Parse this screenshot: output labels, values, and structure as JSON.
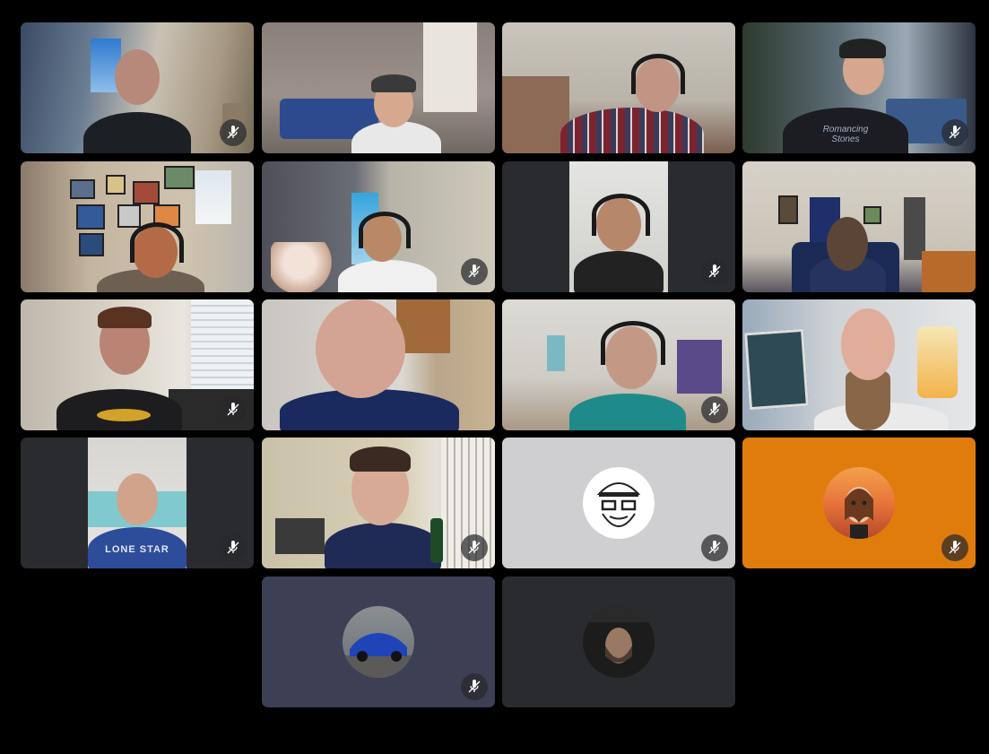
{
  "meeting": {
    "tiles": [
      {
        "id": "p1",
        "type": "video",
        "muted": true
      },
      {
        "id": "p2",
        "type": "video",
        "muted": false
      },
      {
        "id": "p3",
        "type": "video",
        "muted": false
      },
      {
        "id": "p4",
        "type": "video",
        "muted": true
      },
      {
        "id": "p5",
        "type": "video",
        "muted": false
      },
      {
        "id": "p6",
        "type": "video",
        "muted": true
      },
      {
        "id": "p7",
        "type": "video",
        "muted": true
      },
      {
        "id": "p8",
        "type": "video",
        "muted": false
      },
      {
        "id": "p9",
        "type": "video",
        "muted": true
      },
      {
        "id": "p10",
        "type": "video",
        "muted": false
      },
      {
        "id": "p11",
        "type": "video",
        "muted": true
      },
      {
        "id": "p12",
        "type": "video",
        "muted": false
      },
      {
        "id": "p13",
        "type": "video",
        "muted": true
      },
      {
        "id": "p14",
        "type": "video",
        "muted": true
      },
      {
        "id": "p15",
        "type": "avatar",
        "muted": true
      },
      {
        "id": "p16",
        "type": "avatar",
        "muted": true
      },
      {
        "id": "p17",
        "type": "avatar",
        "muted": true
      },
      {
        "id": "p18",
        "type": "avatar",
        "muted": false
      }
    ],
    "shirt_text": {
      "p4": "Romancing Stones",
      "p13": "LONE STAR"
    },
    "colors": {
      "background": "#000000",
      "tile_dark": "#2a2b2f",
      "tile_light_gray": "#cfcfd1",
      "tile_orange": "#e07c0c",
      "tile_slate": "#3d3f55",
      "mute_badge": "#28282c"
    }
  }
}
